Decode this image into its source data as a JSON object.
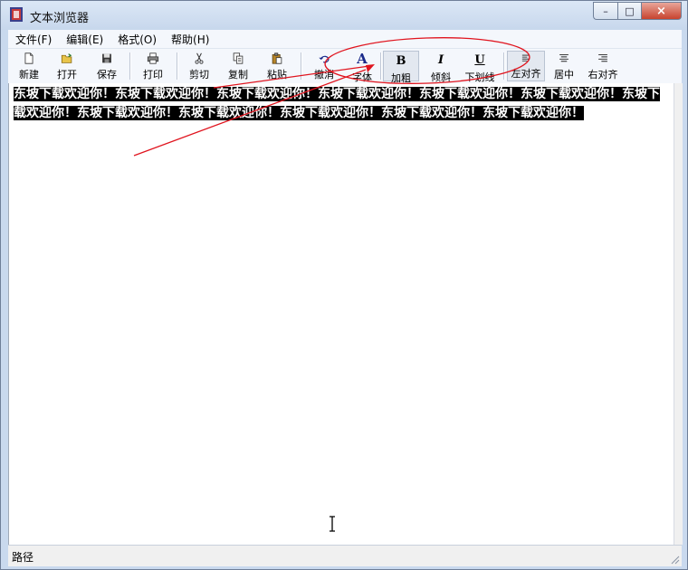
{
  "window": {
    "title": "文本浏览器",
    "minimize": "–",
    "maximize": "□",
    "close": "×"
  },
  "menu": [
    "文件(F)",
    "编辑(E)",
    "格式(O)",
    "帮助(H)"
  ],
  "toolbar": {
    "new": "新建",
    "open": "打开",
    "save": "保存",
    "print": "打印",
    "cut": "剪切",
    "copy": "复制",
    "paste": "粘贴",
    "undo": "撤消",
    "font": "字体",
    "bold": "加粗",
    "italic": "倾斜",
    "underline": "下划线",
    "align_left": "左对齐",
    "align_center": "居中",
    "align_right": "右对齐",
    "font_glyph": "A",
    "bold_glyph": "B",
    "italic_glyph": "I",
    "underline_glyph": "U"
  },
  "document": {
    "selected_text": "东坡下载欢迎你！东坡下载欢迎你！东坡下载欢迎你！东坡下载欢迎你！东坡下载欢迎你！东坡下载欢迎你！东坡下载欢迎你！东坡下载欢迎你！东坡下载欢迎你！东坡下载欢迎你！东坡下载欢迎你！东坡下载欢迎你！"
  },
  "statusbar": {
    "text": "路径"
  },
  "colors": {
    "selection_bg": "#000000",
    "selection_fg": "#ffffff",
    "annotation": "#e0141e",
    "font_icon": "#1a2a8a"
  },
  "icons": [
    "app-icon",
    "new-file-icon",
    "open-folder-icon",
    "save-disk-icon",
    "printer-icon",
    "scissors-icon",
    "copy-icon",
    "paste-icon",
    "undo-icon",
    "align-left-icon",
    "align-center-icon",
    "align-right-icon",
    "text-cursor-icon",
    "resize-grip-icon"
  ]
}
